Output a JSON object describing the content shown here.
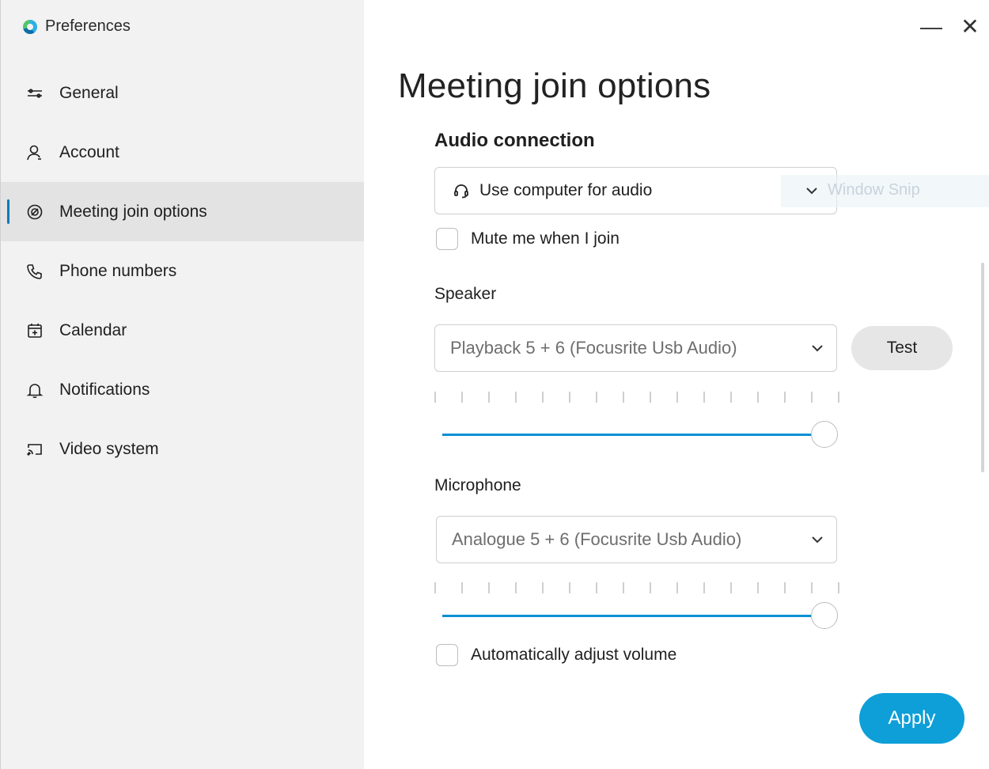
{
  "window": {
    "title": "Preferences",
    "minimize_glyph": "—",
    "close_glyph": "✕"
  },
  "sidebar": {
    "items": [
      {
        "label": "General",
        "icon": "sliders-icon",
        "active": false
      },
      {
        "label": "Account",
        "icon": "user-icon",
        "active": false
      },
      {
        "label": "Meeting join options",
        "icon": "join-icon",
        "active": true
      },
      {
        "label": "Phone numbers",
        "icon": "phone-icon",
        "active": false
      },
      {
        "label": "Calendar",
        "icon": "calendar-icon",
        "active": false
      },
      {
        "label": "Notifications",
        "icon": "bell-icon",
        "active": false
      },
      {
        "label": "Video system",
        "icon": "cast-icon",
        "active": false
      }
    ]
  },
  "main": {
    "title": "Meeting join options",
    "audio_connection": {
      "heading": "Audio connection",
      "selected": "Use computer for audio",
      "mute_label": "Mute me when I join",
      "mute_checked": false
    },
    "speaker": {
      "label": "Speaker",
      "selected": "Playback 5 + 6 (Focusrite Usb Audio)",
      "test_label": "Test",
      "volume_percent": 100
    },
    "microphone": {
      "label": "Microphone",
      "selected": "Analogue 5 + 6 (Focusrite Usb Audio)",
      "volume_percent": 100
    },
    "auto_adjust_label": "Automatically adjust volume",
    "auto_adjust_checked": false,
    "apply_label": "Apply"
  },
  "overlay": {
    "snip_text": "Window Snip"
  },
  "colors": {
    "accent": "#0e9fd8",
    "slider": "#0b8fd3",
    "sidebar_bg": "#f2f2f2",
    "active_bg": "#e3e3e3"
  }
}
